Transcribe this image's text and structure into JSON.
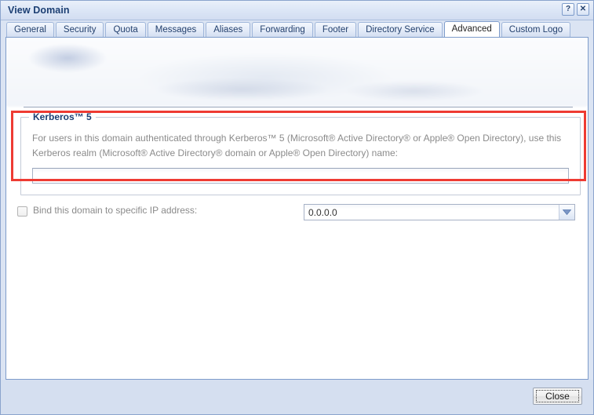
{
  "window": {
    "title": "View Domain",
    "help_button": "?",
    "close_button": "✕"
  },
  "tabs": [
    {
      "label": "General",
      "active": false
    },
    {
      "label": "Security",
      "active": false
    },
    {
      "label": "Quota",
      "active": false
    },
    {
      "label": "Messages",
      "active": false
    },
    {
      "label": "Aliases",
      "active": false
    },
    {
      "label": "Forwarding",
      "active": false
    },
    {
      "label": "Footer",
      "active": false
    },
    {
      "label": "Directory Service",
      "active": false
    },
    {
      "label": "Advanced",
      "active": true
    },
    {
      "label": "Custom Logo",
      "active": false
    }
  ],
  "content": {
    "kerberos": {
      "legend": "Kerberos™ 5",
      "description": "For users in this domain authenticated through Kerberos™ 5 (Microsoft® Active Directory® or Apple® Open Directory), use this Kerberos realm (Microsoft® Active Directory® domain or Apple® Open Directory) name:",
      "realm_value": "",
      "realm_placeholder": ""
    },
    "bind_ip": {
      "label": "Bind this domain to specific IP address:",
      "checked": false,
      "selected_value": "0.0.0.0",
      "options": [
        "0.0.0.0"
      ]
    }
  },
  "footer": {
    "close_label": "Close"
  },
  "colors": {
    "annotation_red": "#ee3b33",
    "title_blue": "#1c3f73",
    "window_chrome": "#dbe4f3",
    "footer_bg": "#d5dff0",
    "muted_text": "#8b8b8b"
  }
}
